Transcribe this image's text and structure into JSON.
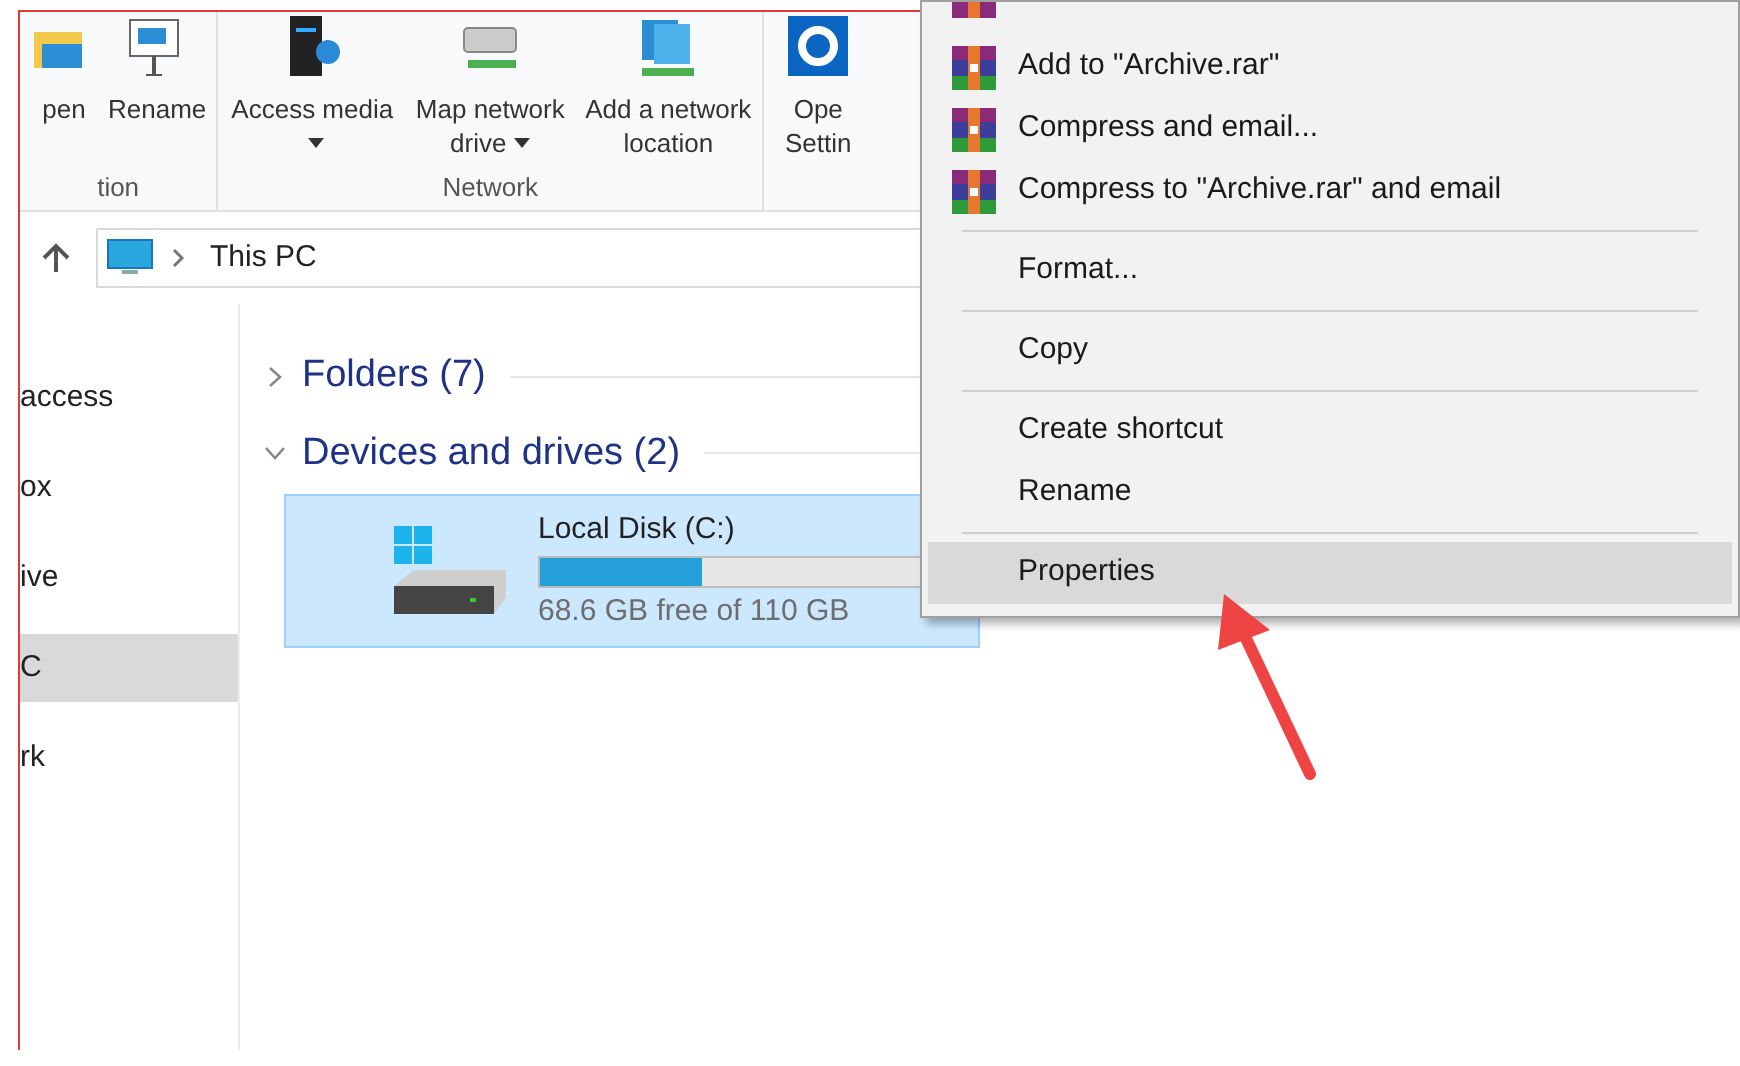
{
  "ribbon": {
    "groups": [
      {
        "label": "tion",
        "buttons": [
          {
            "label": "pen",
            "dropdown": false
          },
          {
            "label": "Rename",
            "dropdown": false
          }
        ]
      },
      {
        "label": "Network",
        "buttons": [
          {
            "label": "Access media",
            "dropdown": true
          },
          {
            "label": "Map network drive",
            "dropdown": true
          },
          {
            "label": "Add a network location",
            "dropdown": false
          }
        ]
      },
      {
        "buttons": [
          {
            "label": "Ope Settin",
            "dropdown": false
          }
        ]
      }
    ]
  },
  "address": {
    "path": "This PC"
  },
  "sidebar": {
    "items": [
      {
        "label": "access",
        "selected": false
      },
      {
        "label": "ox",
        "selected": false
      },
      {
        "label": "ive",
        "selected": false
      },
      {
        "label": "C",
        "selected": true
      },
      {
        "label": "rk",
        "selected": false
      }
    ]
  },
  "sections": [
    {
      "title": "Folders (7)",
      "expanded": false
    },
    {
      "title": "Devices and drives (2)",
      "expanded": true
    }
  ],
  "drive": {
    "name": "Local Disk (C:)",
    "level": 0.38,
    "free": "68.6 GB free of 110 GB",
    "selected": true
  },
  "context_menu": {
    "items": [
      {
        "kind": "rar",
        "label": "Add to \"Archive.rar\"",
        "selected": false
      },
      {
        "kind": "rar",
        "label": "Compress and email...",
        "selected": false
      },
      {
        "kind": "rar",
        "label": "Compress to \"Archive.rar\" and email",
        "selected": false
      },
      {
        "kind": "separator"
      },
      {
        "kind": "plain",
        "label": "Format...",
        "selected": false
      },
      {
        "kind": "separator"
      },
      {
        "kind": "plain",
        "label": "Copy",
        "selected": false
      },
      {
        "kind": "separator"
      },
      {
        "kind": "plain",
        "label": "Create shortcut",
        "selected": false
      },
      {
        "kind": "plain",
        "label": "Rename",
        "selected": false
      },
      {
        "kind": "separator"
      },
      {
        "kind": "plain",
        "label": "Properties",
        "selected": true
      }
    ]
  }
}
